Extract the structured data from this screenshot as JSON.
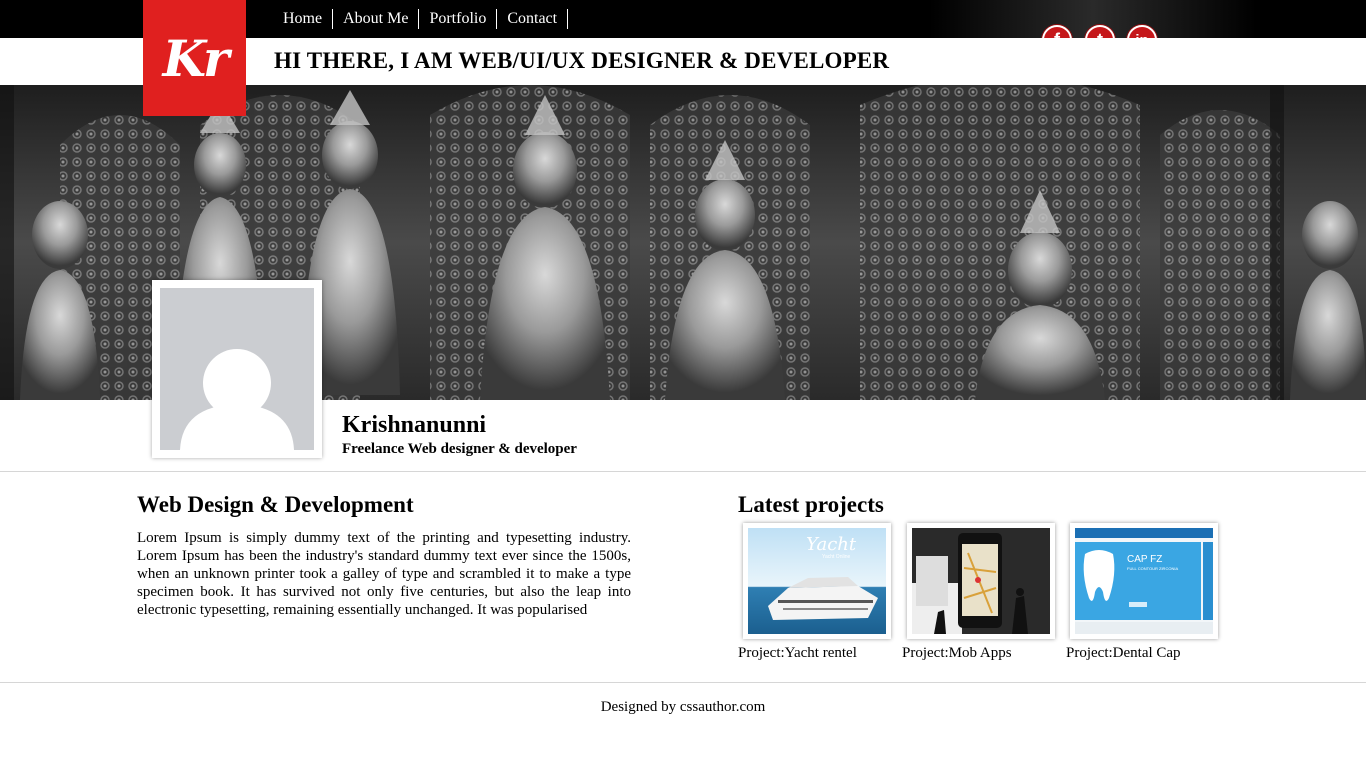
{
  "nav": {
    "items": [
      "Home",
      "About Me",
      "Portfolio",
      "Contact"
    ]
  },
  "header": {
    "logo_text": "Kr",
    "headline": "HI THERE, I AM WEB/UI/UX DESIGNER & DEVELOPER",
    "social": [
      {
        "name": "facebook-icon",
        "glyph": "f"
      },
      {
        "name": "twitter-icon",
        "glyph": "t"
      },
      {
        "name": "linkedin-icon",
        "glyph": "in"
      }
    ]
  },
  "profile": {
    "name": "Krishnanunni",
    "role": "Freelance Web designer & developer"
  },
  "about": {
    "title": "Web Design & Development",
    "text": "Lorem Ipsum is simply dummy text of the printing and typesetting industry. Lorem Ipsum has been the industry's standard dummy text ever since the 1500s, when an unknown printer took a galley of type and scrambled it to make a type specimen book. It has survived not only five centuries, but also the leap into electronic typesetting, remaining essentially unchanged. It was popularised"
  },
  "projects": {
    "title": "Latest projects",
    "items": [
      {
        "caption": "Project:Yacht rentel",
        "thumb_title": "Yacht",
        "thumb_sub": "Yacht Online"
      },
      {
        "caption": "Project:Mob Apps"
      },
      {
        "caption": "Project:Dental Cap",
        "thumb_title": "CAP FZ",
        "thumb_sub": "FULL CONTOUR ZIRCONIA"
      }
    ]
  },
  "footer": {
    "text": "Designed by cssauthor.com"
  },
  "colors": {
    "brand_red": "#e0201f",
    "social_red": "#c5171a"
  }
}
